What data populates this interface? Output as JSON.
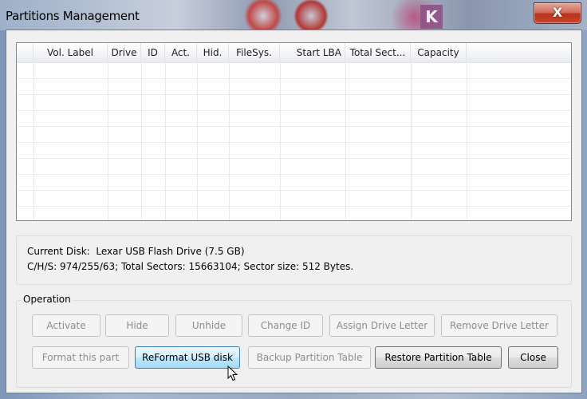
{
  "window": {
    "title": "Partitions Management",
    "close_glyph": "X",
    "background_badge": "K"
  },
  "table": {
    "columns": [
      "",
      "Vol. Label",
      "Drive",
      "ID",
      "Act.",
      "Hid.",
      "FileSys.",
      "Start LBA",
      "Total Sect...",
      "Capacity",
      ""
    ],
    "rows": []
  },
  "disk_info": {
    "current_disk_label": "Current Disk:",
    "current_disk_value": "Lexar USB Flash Drive (7.5 GB)",
    "geometry_line": "C/H/S: 974/255/63; Total Sectors: 15663104; Sector size: 512 Bytes."
  },
  "operation": {
    "group_label": "Operation",
    "buttons": {
      "activate": "Activate",
      "hide": "Hide",
      "unhide": "Unhide",
      "change_id": "Change ID",
      "assign_drive_letter": "Assign Drive Letter",
      "remove_drive_letter": "Remove Drive Letter",
      "format_this_part": "Format this part",
      "reformat_usb_disk": "ReFormat USB disk",
      "backup_partition_table": "Backup Partition Table",
      "restore_partition_table": "Restore Partition Table",
      "close": "Close"
    }
  },
  "colors": {
    "hover_button": "#bee6fd",
    "close_button": "#c9462e",
    "disabled_text": "#8d8d8d"
  }
}
